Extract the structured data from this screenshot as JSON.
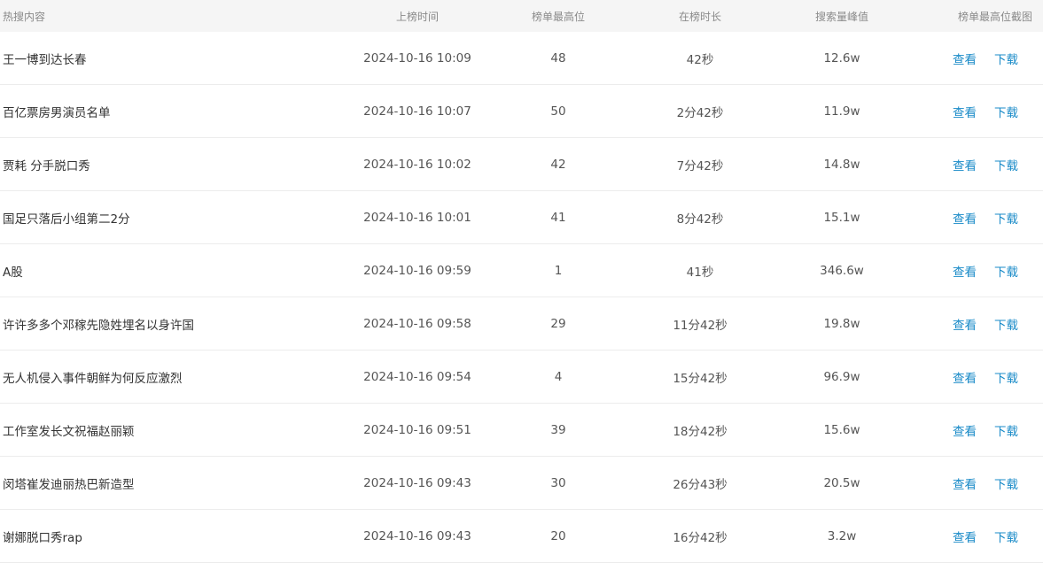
{
  "columns": {
    "name": "热搜内容",
    "time": "上榜时间",
    "rank": "榜单最高位",
    "duration": "在榜时长",
    "peak": "搜索量峰值",
    "screenshot": "榜单最高位截图"
  },
  "actions": {
    "view": "查看",
    "download": "下载"
  },
  "colors": {
    "link": "#1a8bc8",
    "header_bg": "#f5f5f5"
  },
  "rows": [
    {
      "name": "王一博到达长春",
      "time": "2024-10-16 10:09",
      "rank": "48",
      "duration": "42秒",
      "peak": "12.6w"
    },
    {
      "name": "百亿票房男演员名单",
      "time": "2024-10-16 10:07",
      "rank": "50",
      "duration": "2分42秒",
      "peak": "11.9w"
    },
    {
      "name": "贾耗 分手脱口秀",
      "time": "2024-10-16 10:02",
      "rank": "42",
      "duration": "7分42秒",
      "peak": "14.8w"
    },
    {
      "name": "国足只落后小组第二2分",
      "time": "2024-10-16 10:01",
      "rank": "41",
      "duration": "8分42秒",
      "peak": "15.1w"
    },
    {
      "name": "A股",
      "time": "2024-10-16 09:59",
      "rank": "1",
      "duration": "41秒",
      "peak": "346.6w"
    },
    {
      "name": "许许多多个邓稼先隐姓埋名以身许国",
      "time": "2024-10-16 09:58",
      "rank": "29",
      "duration": "11分42秒",
      "peak": "19.8w"
    },
    {
      "name": "无人机侵入事件朝鲜为何反应激烈",
      "time": "2024-10-16 09:54",
      "rank": "4",
      "duration": "15分42秒",
      "peak": "96.9w"
    },
    {
      "name": "工作室发长文祝福赵丽颖",
      "time": "2024-10-16 09:51",
      "rank": "39",
      "duration": "18分42秒",
      "peak": "15.6w"
    },
    {
      "name": "闵塔崔发迪丽热巴新造型",
      "time": "2024-10-16 09:43",
      "rank": "30",
      "duration": "26分43秒",
      "peak": "20.5w"
    },
    {
      "name": "谢娜脱口秀rap",
      "time": "2024-10-16 09:43",
      "rank": "20",
      "duration": "16分42秒",
      "peak": "3.2w"
    }
  ]
}
